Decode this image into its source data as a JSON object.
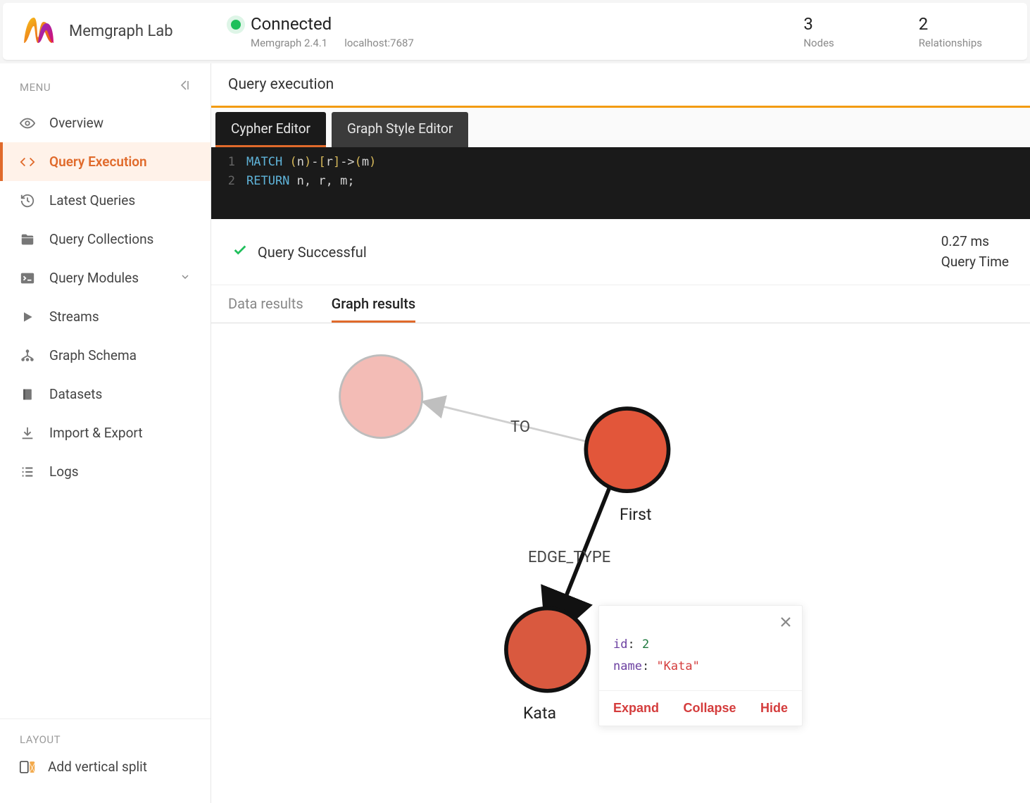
{
  "brand": "Memgraph Lab",
  "connection": {
    "status": "Connected",
    "version": "Memgraph 2.4.1",
    "host": "localhost:7687"
  },
  "stats": {
    "nodes_count": "3",
    "nodes_label": "Nodes",
    "rel_count": "2",
    "rel_label": "Relationships"
  },
  "sidebar": {
    "menu_label": "MENU",
    "items": [
      {
        "label": "Overview"
      },
      {
        "label": "Query Execution"
      },
      {
        "label": "Latest Queries"
      },
      {
        "label": "Query Collections"
      },
      {
        "label": "Query Modules"
      },
      {
        "label": "Streams"
      },
      {
        "label": "Graph Schema"
      },
      {
        "label": "Datasets"
      },
      {
        "label": "Import & Export"
      },
      {
        "label": "Logs"
      }
    ],
    "layout_label": "LAYOUT",
    "layout_item": "Add vertical split"
  },
  "page": {
    "title": "Query execution",
    "editor_tabs": {
      "cypher": "Cypher Editor",
      "style": "Graph Style Editor"
    },
    "code": {
      "l1_kw": "MATCH",
      "l1_rest": "(n)-[r]->(m)",
      "l2_kw": "RETURN",
      "l2_rest": "n, r, m;"
    },
    "status": {
      "text": "Query Successful",
      "time_value": "0.27 ms",
      "time_label": "Query Time"
    },
    "result_tabs": {
      "data": "Data results",
      "graph": "Graph results"
    }
  },
  "graph": {
    "edge_to": "TO",
    "edge_type": "EDGE_TYPE",
    "node_first": "First",
    "node_kata": "Kata"
  },
  "popup": {
    "id_key": "id",
    "id_val": "2",
    "name_key": "name",
    "name_val": "\"Kata\"",
    "expand": "Expand",
    "collapse": "Collapse",
    "hide": "Hide"
  }
}
